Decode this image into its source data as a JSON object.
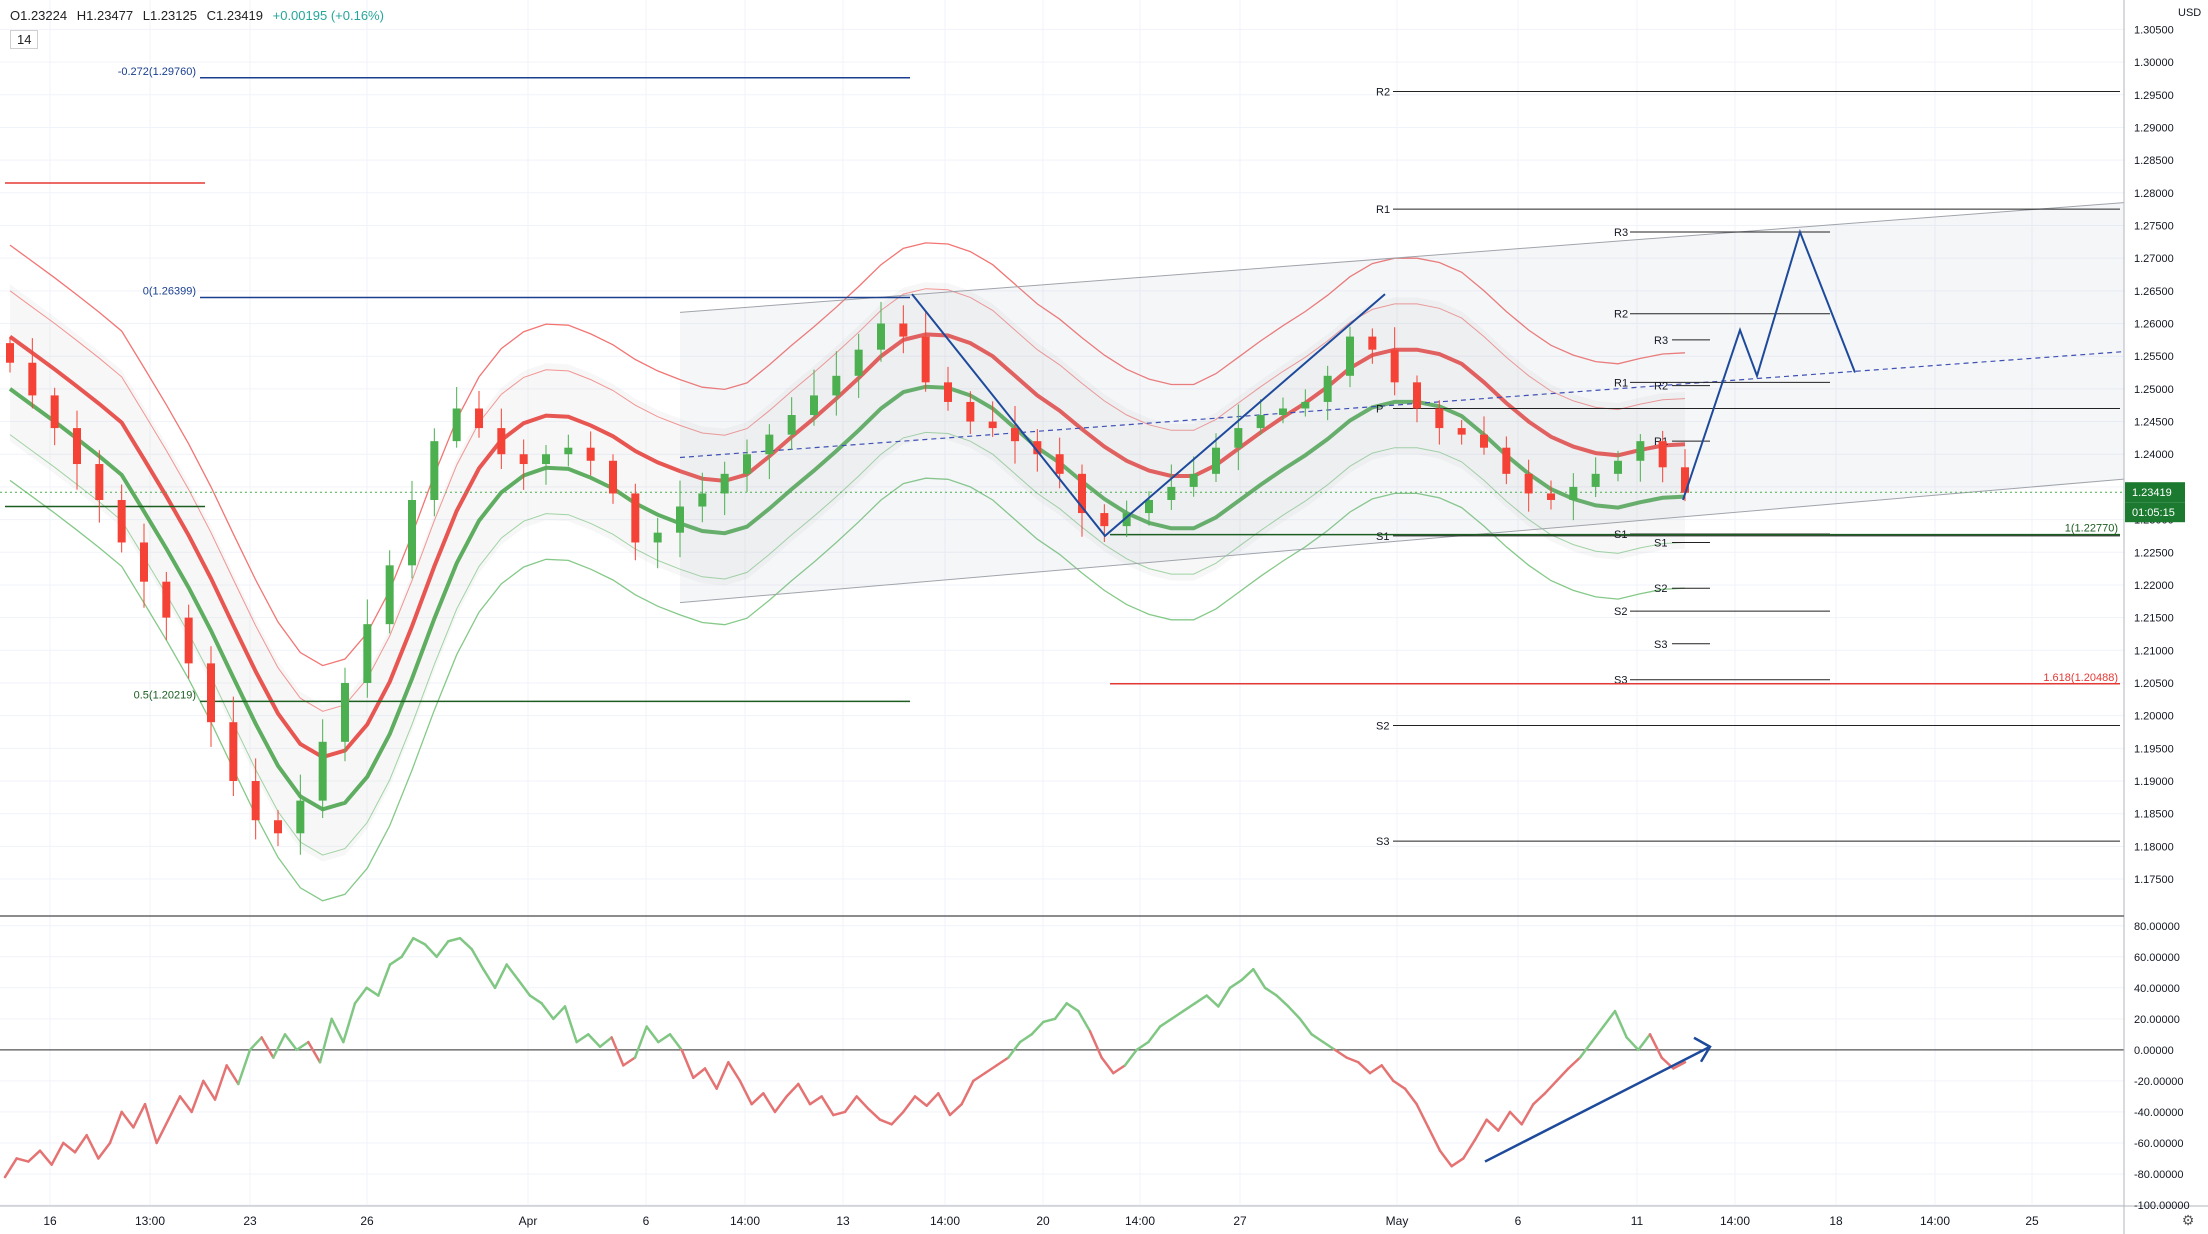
{
  "header": {
    "open": "O1.23224",
    "high": "H1.23477",
    "low": "L1.23125",
    "close": "C1.23419",
    "change": "+0.00195 (+0.16%)",
    "rsi_length": "14",
    "currency": "USD"
  },
  "price_tag": {
    "price": "1.23419",
    "countdown": "01:05:15"
  },
  "colors": {
    "bull": "#4caf50",
    "bear": "#f44336",
    "bull_band": "#66bb6a",
    "bear_band": "#ef5350",
    "fib": "#1a3f8f",
    "osc_up": "#81c784",
    "osc_down": "#e57373"
  },
  "chart_data": [
    {
      "type": "candlestick",
      "title": "",
      "y_range": [
        1.1695,
        1.3095
      ],
      "y_ticks": [
        "1.30500",
        "1.30000",
        "1.29500",
        "1.29000",
        "1.28500",
        "1.28000",
        "1.27500",
        "1.27000",
        "1.26500",
        "1.26000",
        "1.25500",
        "1.25000",
        "1.24500",
        "1.24000",
        "1.23500",
        "1.23000",
        "1.22500",
        "1.22000",
        "1.21500",
        "1.21000",
        "1.20500",
        "1.20000",
        "1.19500",
        "1.19000",
        "1.18500",
        "1.18000",
        "1.17500"
      ],
      "x_tick_labels": [
        "16",
        "13:00",
        "23",
        "26",
        "Apr",
        "6",
        "14:00",
        "13",
        "14:00",
        "20",
        "14:00",
        "27",
        "May",
        "6",
        "11",
        "14:00",
        "18",
        "14:00",
        "25"
      ],
      "close_series": [
        1.254,
        1.249,
        1.244,
        1.2385,
        1.233,
        1.2265,
        1.2205,
        1.215,
        1.208,
        1.199,
        1.19,
        1.184,
        1.182,
        1.187,
        1.196,
        1.205,
        1.214,
        1.223,
        1.233,
        1.242,
        1.247,
        1.244,
        1.24,
        1.2385,
        1.24,
        1.241,
        1.239,
        1.234,
        1.2265,
        1.228,
        1.232,
        1.234,
        1.237,
        1.24,
        1.243,
        1.246,
        1.249,
        1.252,
        1.256,
        1.26,
        1.258,
        1.251,
        1.248,
        1.245,
        1.244,
        1.242,
        1.24,
        1.237,
        1.231,
        1.229,
        1.231,
        1.233,
        1.235,
        1.237,
        1.241,
        1.244,
        1.246,
        1.247,
        1.248,
        1.252,
        1.258,
        1.256,
        1.251,
        1.247,
        1.244,
        1.243,
        1.241,
        1.237,
        1.234,
        1.233,
        1.235,
        1.237,
        1.239,
        1.242,
        1.238,
        1.2341
      ],
      "pivots_daily": [
        {
          "label": "R2",
          "value": 1.2955
        },
        {
          "label": "R1",
          "value": 1.2775
        },
        {
          "label": "S1",
          "value": 1.2275
        },
        {
          "label": "S2",
          "value": 1.1985
        },
        {
          "label": "S3",
          "value": 1.1808
        }
      ],
      "pivots_weekly": [
        {
          "label": "R3",
          "value": 1.274
        },
        {
          "label": "R2",
          "value": 1.2615
        },
        {
          "label": "R1",
          "value": 1.251
        },
        {
          "label": "S1",
          "value": 1.2278
        },
        {
          "label": "S2",
          "value": 1.216
        },
        {
          "label": "S3",
          "value": 1.2055
        }
      ],
      "pivots_small": [
        {
          "label": "R3",
          "value": 1.2575
        },
        {
          "label": "R2",
          "value": 1.2505
        },
        {
          "label": "R1",
          "value": 1.242
        },
        {
          "label": "S1",
          "value": 1.2265
        },
        {
          "label": "S2",
          "value": 1.2195
        },
        {
          "label": "S3",
          "value": 1.211
        }
      ],
      "pivot_p": {
        "label": "P",
        "value": 1.247
      },
      "fib_levels": [
        {
          "label": "-0.272(1.29760)",
          "value": 1.2976
        },
        {
          "label": "0(1.26399)",
          "value": 1.26399
        },
        {
          "label": "0.5(1.20219)",
          "value": 1.20219
        },
        {
          "label": "1(1.22770)",
          "value": 1.2277
        },
        {
          "label": "1.618(1.20488)",
          "value": 1.20488
        }
      ],
      "current_price": 1.23419
    },
    {
      "type": "line",
      "title": "",
      "y_range": [
        -100,
        85
      ],
      "y_ticks": [
        "80.00000",
        "60.00000",
        "40.00000",
        "20.00000",
        "0.00000",
        "-20.00000",
        "-40.00000",
        "-60.00000",
        "-80.00000",
        "-100.00000"
      ],
      "values": [
        -82,
        -70,
        -72,
        -65,
        -74,
        -60,
        -66,
        -55,
        -70,
        -60,
        -40,
        -50,
        -35,
        -60,
        -45,
        -30,
        -40,
        -20,
        -32,
        -10,
        -22,
        0,
        8,
        -5,
        10,
        0,
        5,
        -8,
        20,
        5,
        30,
        40,
        35,
        55,
        60,
        72,
        68,
        60,
        70,
        72,
        65,
        52,
        40,
        55,
        45,
        35,
        30,
        20,
        28,
        5,
        10,
        2,
        8,
        -10,
        -5,
        15,
        5,
        10,
        0,
        -18,
        -12,
        -25,
        -8,
        -20,
        -35,
        -28,
        -40,
        -30,
        -22,
        -35,
        -30,
        -42,
        -40,
        -30,
        -38,
        -45,
        -48,
        -40,
        -30,
        -36,
        -28,
        -42,
        -35,
        -20,
        -15,
        -10,
        -5,
        5,
        10,
        18,
        20,
        30,
        25,
        12,
        -5,
        -15,
        -10,
        0,
        5,
        15,
        20,
        25,
        30,
        35,
        28,
        40,
        45,
        52,
        40,
        35,
        28,
        20,
        10,
        5,
        0,
        -5,
        -8,
        -15,
        -10,
        -20,
        -25,
        -35,
        -50,
        -65,
        -75,
        -70,
        -58,
        -45,
        -52,
        -40,
        -48,
        -35,
        -28,
        -20,
        -12,
        -5,
        5,
        15,
        25,
        8,
        0,
        10,
        -5,
        -12,
        -8
      ],
      "zero_line": 0
    }
  ]
}
